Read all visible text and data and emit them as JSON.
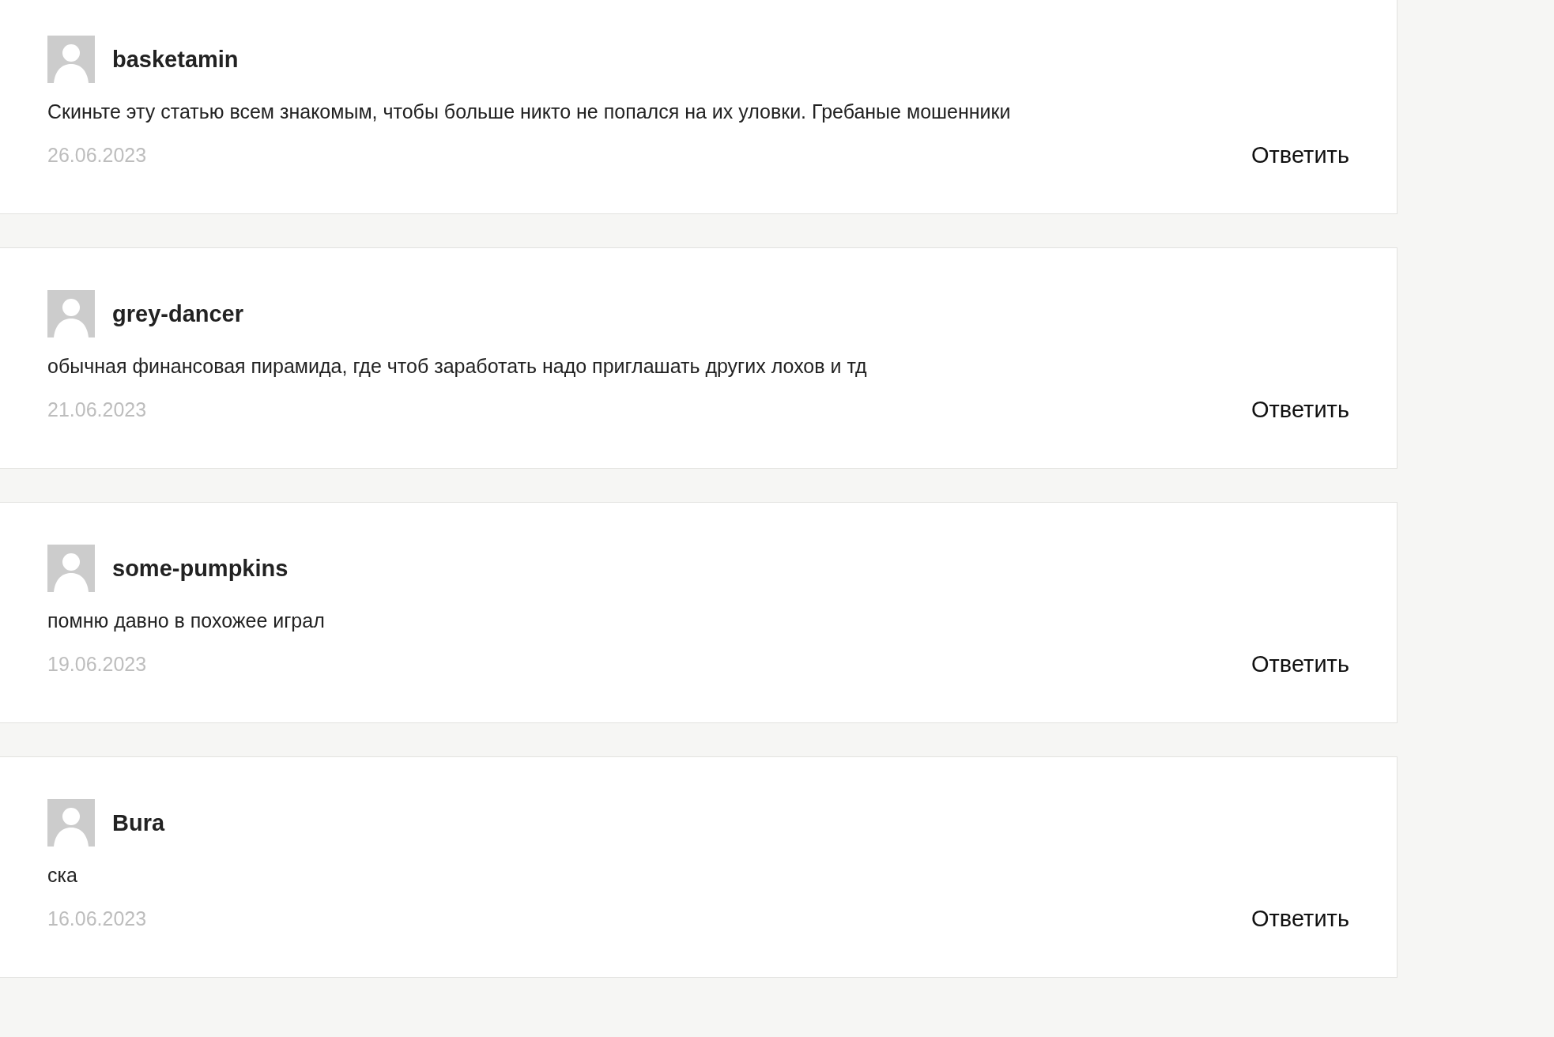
{
  "comments": [
    {
      "author": "basketamin",
      "text": "Скиньте эту статью всем знакомым, чтобы больше никто не попался на их уловки. Гребаные мошенники",
      "date": "26.06.2023",
      "reply": "Ответить"
    },
    {
      "author": "grey-dancer",
      "text": "обычная финансовая пирамида, где чтоб заработать надо приглашать других лохов и тд",
      "date": "21.06.2023",
      "reply": "Ответить"
    },
    {
      "author": "some-pumpkins",
      "text": "помню давно в похожее играл",
      "date": "19.06.2023",
      "reply": "Ответить"
    },
    {
      "author": "Bura",
      "text": "ска",
      "date": "16.06.2023",
      "reply": "Ответить"
    }
  ]
}
